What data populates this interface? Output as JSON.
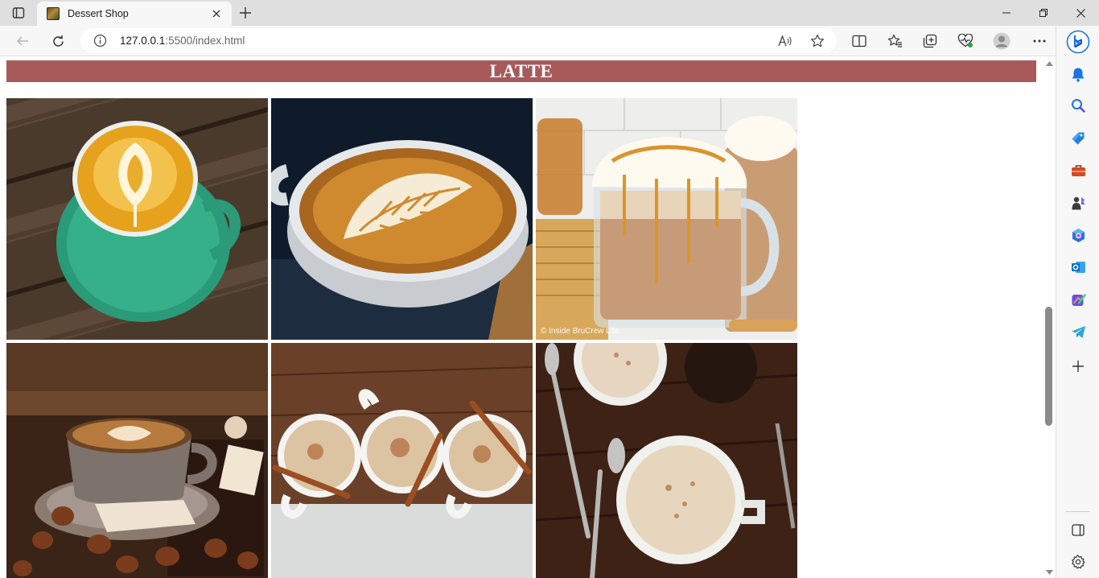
{
  "browser": {
    "tab_title": "Dessert Shop",
    "url_host": "127.0.0.1",
    "url_rest": ":5500/index.html",
    "window_controls": [
      "minimize-icon",
      "restore-icon",
      "close-icon"
    ],
    "toolbar_icons": [
      "back-icon",
      "refresh-icon",
      "site-info-icon",
      "read-aloud-icon",
      "favorite-star-icon",
      "split-screen-icon",
      "favorites-icon",
      "collections-icon",
      "browser-essentials-icon",
      "profile-icon",
      "more-menu-icon",
      "copilot-icon"
    ],
    "sidebar_icons": [
      "notifications-icon",
      "search-icon",
      "shopping-icon",
      "tools-icon",
      "games-icon",
      "microsoft-365-icon",
      "outlook-icon",
      "designer-icon",
      "telegram-icon",
      "add-icon",
      "hide-sidebar-icon",
      "settings-icon"
    ],
    "accent_color": "#1a73e8"
  },
  "page": {
    "heading": "LATTE",
    "heading_bg": "#a85a5b",
    "photo_grid": [
      {
        "name": "latte-art-green-cup",
        "watermark": ""
      },
      {
        "name": "latte-art-white-cup",
        "watermark": ""
      },
      {
        "name": "caramel-latte-glass-mug",
        "watermark": "© Inside BruCrew Life"
      },
      {
        "name": "hazelnut-latte",
        "watermark": ""
      },
      {
        "name": "chai-latte-three-cups",
        "watermark": ""
      },
      {
        "name": "cinnamon-latte-spoons",
        "watermark": ""
      }
    ]
  }
}
